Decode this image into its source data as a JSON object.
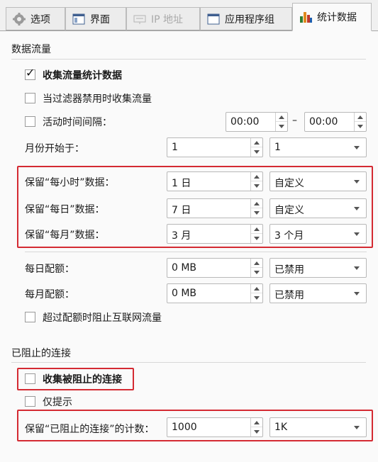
{
  "tabs": [
    {
      "label": "选项",
      "icon": "gear-icon"
    },
    {
      "label": "界面",
      "icon": "window-icon"
    },
    {
      "label": "IP 地址",
      "icon": "network-icon",
      "disabled": true
    },
    {
      "label": "应用程序组",
      "icon": "app-group-icon"
    },
    {
      "label": "统计数据",
      "icon": "bar-chart-icon",
      "active": true
    }
  ],
  "traffic": {
    "title": "数据流量",
    "collect_stats": {
      "label": "收集流量统计数据",
      "checked": true
    },
    "collect_when_filter_disabled": {
      "label": "当过滤器禁用时收集流量",
      "checked": false
    },
    "active_interval": {
      "label": "活动时间间隔：",
      "checked": false,
      "from": "00:00",
      "dash": "–",
      "to": "00:00"
    },
    "month_start": {
      "label": "月份开始于：",
      "value": "1",
      "option": "1"
    },
    "keep_hourly": {
      "label": "保留“每小时”数据：",
      "value": "1 日",
      "option": "自定义"
    },
    "keep_daily": {
      "label": "保留“每日”数据：",
      "value": "7 日",
      "option": "自定义"
    },
    "keep_monthly": {
      "label": "保留“每月”数据：",
      "value": "3 月",
      "option": "3 个月"
    },
    "daily_quota": {
      "label": "每日配额：",
      "value": "0 MB",
      "option": "已禁用"
    },
    "monthly_quota": {
      "label": "每月配额：",
      "value": "0 MB",
      "option": "已禁用"
    },
    "block_over_quota": {
      "label": "超过配额时阻止互联网流量",
      "checked": false
    }
  },
  "blocked": {
    "title": "已阻止的连接",
    "collect_blocked": {
      "label": "收集被阻止的连接",
      "checked": false
    },
    "notify_only": {
      "label": "仅提示",
      "checked": false
    },
    "keep_count": {
      "label": "保留“已阻止的连接”的计数：",
      "value": "1000",
      "option": "1K"
    }
  },
  "colors": {
    "highlight": "#d42a32",
    "panel": "#fafafa",
    "tabbar": "#f0f0f0"
  }
}
